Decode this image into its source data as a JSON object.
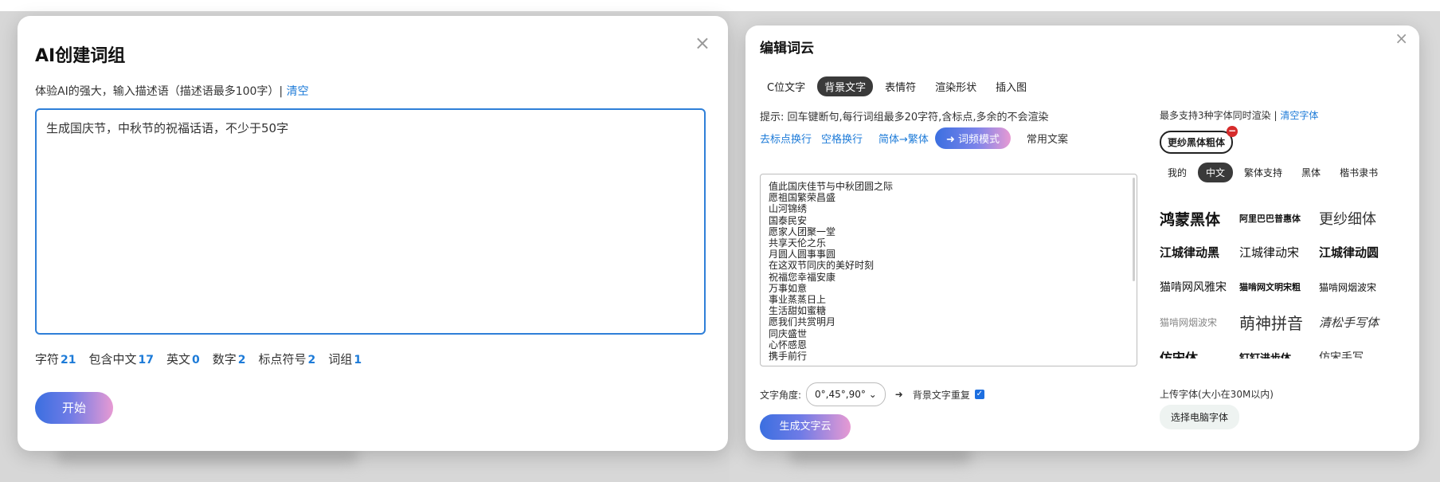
{
  "modal_ai": {
    "title": "AI创建词组",
    "close": "×",
    "description": "体验AI的强大，输入描述语（描述语最多100字）|",
    "clear_link": "清空",
    "textarea_value": "生成国庆节，中秋节的祝福话语，不少于50字",
    "stats": [
      {
        "label": "字符",
        "value": "21"
      },
      {
        "label": "包含中文",
        "value": "17"
      },
      {
        "label": "英文",
        "value": "0"
      },
      {
        "label": "数字",
        "value": "2"
      },
      {
        "label": "标点符号",
        "value": "2"
      },
      {
        "label": "词组",
        "value": "1"
      }
    ],
    "start_button": "开始"
  },
  "modal_cloud": {
    "title": "编辑词云",
    "close": "×",
    "tabs": [
      "C位文字",
      "背景文字",
      "表情符",
      "渲染形状",
      "插入图"
    ],
    "active_tab": 1,
    "hint": "提示: 回车键断句,每行词组最多20字符,含标点,多余的不会渲染",
    "actions": {
      "remove_punct": "去标点换行",
      "space_newline": "空格换行",
      "to_traditional": "简体→繁体",
      "freq_mode": "➜ 词频模式",
      "common_text": "常用文案"
    },
    "words": [
      "值此国庆佳节与中秋团圆之际",
      "愿祖国繁荣昌盛",
      "山河锦绣",
      "国泰民安",
      "愿家人团聚一堂",
      "共享天伦之乐",
      "月圆人圆事事圆",
      "在这双节同庆的美好时刻",
      "祝福您幸福安康",
      "万事如意",
      "事业蒸蒸日上",
      "生活甜如蜜糖",
      "愿我们共赏明月",
      "同庆盛世",
      "心怀感恩",
      "携手前行"
    ],
    "angle_label": "文字角度:",
    "angle_value": "0°,45°,90°",
    "arrow": "➜",
    "repeat_label": "背景文字重复",
    "repeat_checked": true,
    "generate_button": "生成文字云",
    "fonts_panel": {
      "note": "最多支持3种字体同时渲染 |",
      "clear_fonts": "清空字体",
      "selected_font": "更纱黑体粗体",
      "remove_badge": "−",
      "tabs": [
        "我的",
        "中文",
        "繁体支持",
        "黑体",
        "楷书隶书"
      ],
      "active_tab": 1,
      "font_rows": [
        [
          "鸿蒙黑体",
          "阿里巴巴普惠体",
          "更纱细体"
        ],
        [
          "江城律动黑",
          "江城律动宋",
          "江城律动圆"
        ],
        [
          "猫啃网风雅宋",
          "猫啃网文明宋粗",
          "猫啃网烟波宋"
        ],
        [
          "猫啃网烟波宋",
          "萌神拼音",
          "清松手写体"
        ],
        [
          "仿宋体",
          "钉钉进步体",
          "仿宋手写"
        ]
      ],
      "upload_label": "上传字体(大小在30M以内)",
      "choose_font_button": "选择电脑字体"
    }
  }
}
